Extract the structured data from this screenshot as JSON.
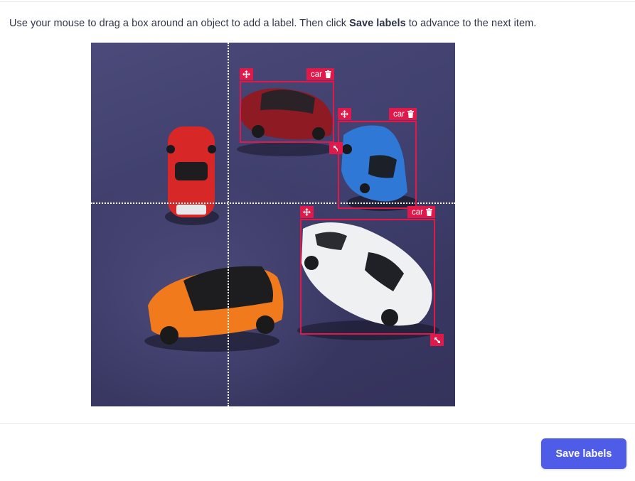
{
  "instructions": {
    "prefix": "Use your mouse to drag a box around an object to add a label. Then click ",
    "emphasis": "Save labels",
    "suffix": " to advance to the next item."
  },
  "annotations": [
    {
      "label": "car"
    },
    {
      "label": "car"
    },
    {
      "label": "car"
    }
  ],
  "icons": {
    "move": "move-arrows-icon",
    "delete": "trash-icon",
    "resize": "resize-diagonal-icon"
  },
  "colors": {
    "annotation": "#e0194a",
    "button": "#4f5ce8",
    "crosshair": "#ffffff"
  },
  "footer": {
    "save_label": "Save labels"
  }
}
